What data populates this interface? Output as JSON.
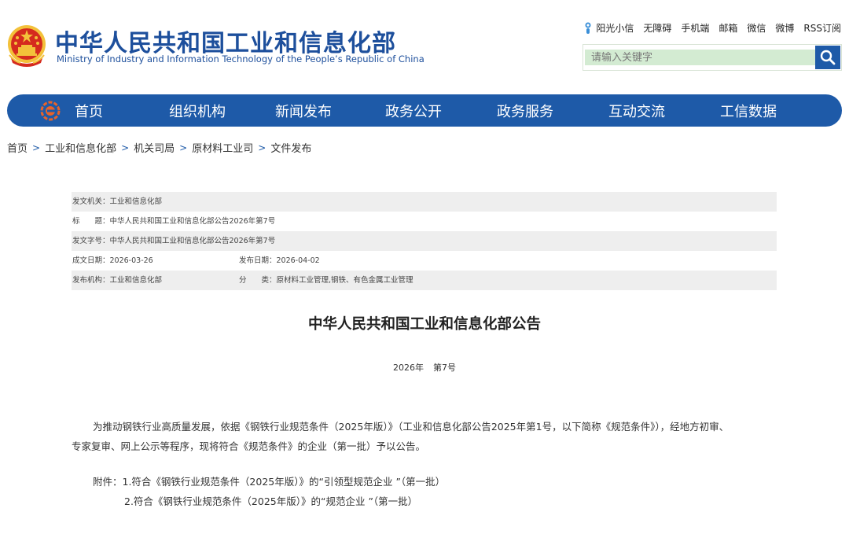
{
  "header": {
    "title": "中华人民共和国工业和信息化部",
    "subtitle": "Ministry of Industry and Information Technology of the People’s Republic of China",
    "top_links": [
      "阳光小信",
      "无障碍",
      "手机端",
      "邮箱",
      "微信",
      "微博",
      "RSS订阅"
    ],
    "search_placeholder": "请输入关键字"
  },
  "nav": {
    "items": [
      "首页",
      "组织机构",
      "新闻发布",
      "政务公开",
      "政务服务",
      "互动交流",
      "工信数据"
    ]
  },
  "breadcrumb": [
    "首页",
    "工业和信息化部",
    "机关司局",
    "原材料工业司",
    "文件发布"
  ],
  "meta": {
    "issuer": "发文机关：工业和信息化部",
    "title": "标　　题：中华人民共和国工业和信息化部公告2026年第7号",
    "doc_no": "发文字号：中华人民共和国工业和信息化部公告2026年第7号",
    "written_date": "成文日期：2026-03-26",
    "publish_date": "发布日期：2026-04-02",
    "publisher": "发布机构：工业和信息化部",
    "category": "分　　类：原材料工业管理,钢铁、有色金属工业管理"
  },
  "document": {
    "title": "中华人民共和国工业和信息化部公告",
    "year": "2026年",
    "number": "第7号",
    "para1_line1": "为推动钢铁行业高质量发展，依据《钢铁行业规范条件（2025年版）》（工业和信息化部公告2025年第1号，以下简称《规范条件》），经地方初审、",
    "para1_line2": "专家复审、网上公示等程序，现将符合《规范条件》的企业（第一批）予以公告。",
    "attachment1": "附件：1.符合《钢铁行业规范条件（2025年版）》的“引领型规范企业 ”（第一批）",
    "attachment2": "2.符合《钢铁行业规范条件（2025年版）》的“规范企业 ”（第一批）"
  },
  "colors": {
    "brand_blue": "#1e5aa8",
    "title_blue": "#1d4f9c",
    "emblem_red": "#d52b1e",
    "emblem_gold": "#f3c13a",
    "search_bg": "#d3ebd2",
    "row_shade": "#eeeeee"
  },
  "icons": [
    "national-emblem-icon",
    "sun-mascot-icon",
    "search-icon",
    "miit-logo-icon"
  ]
}
